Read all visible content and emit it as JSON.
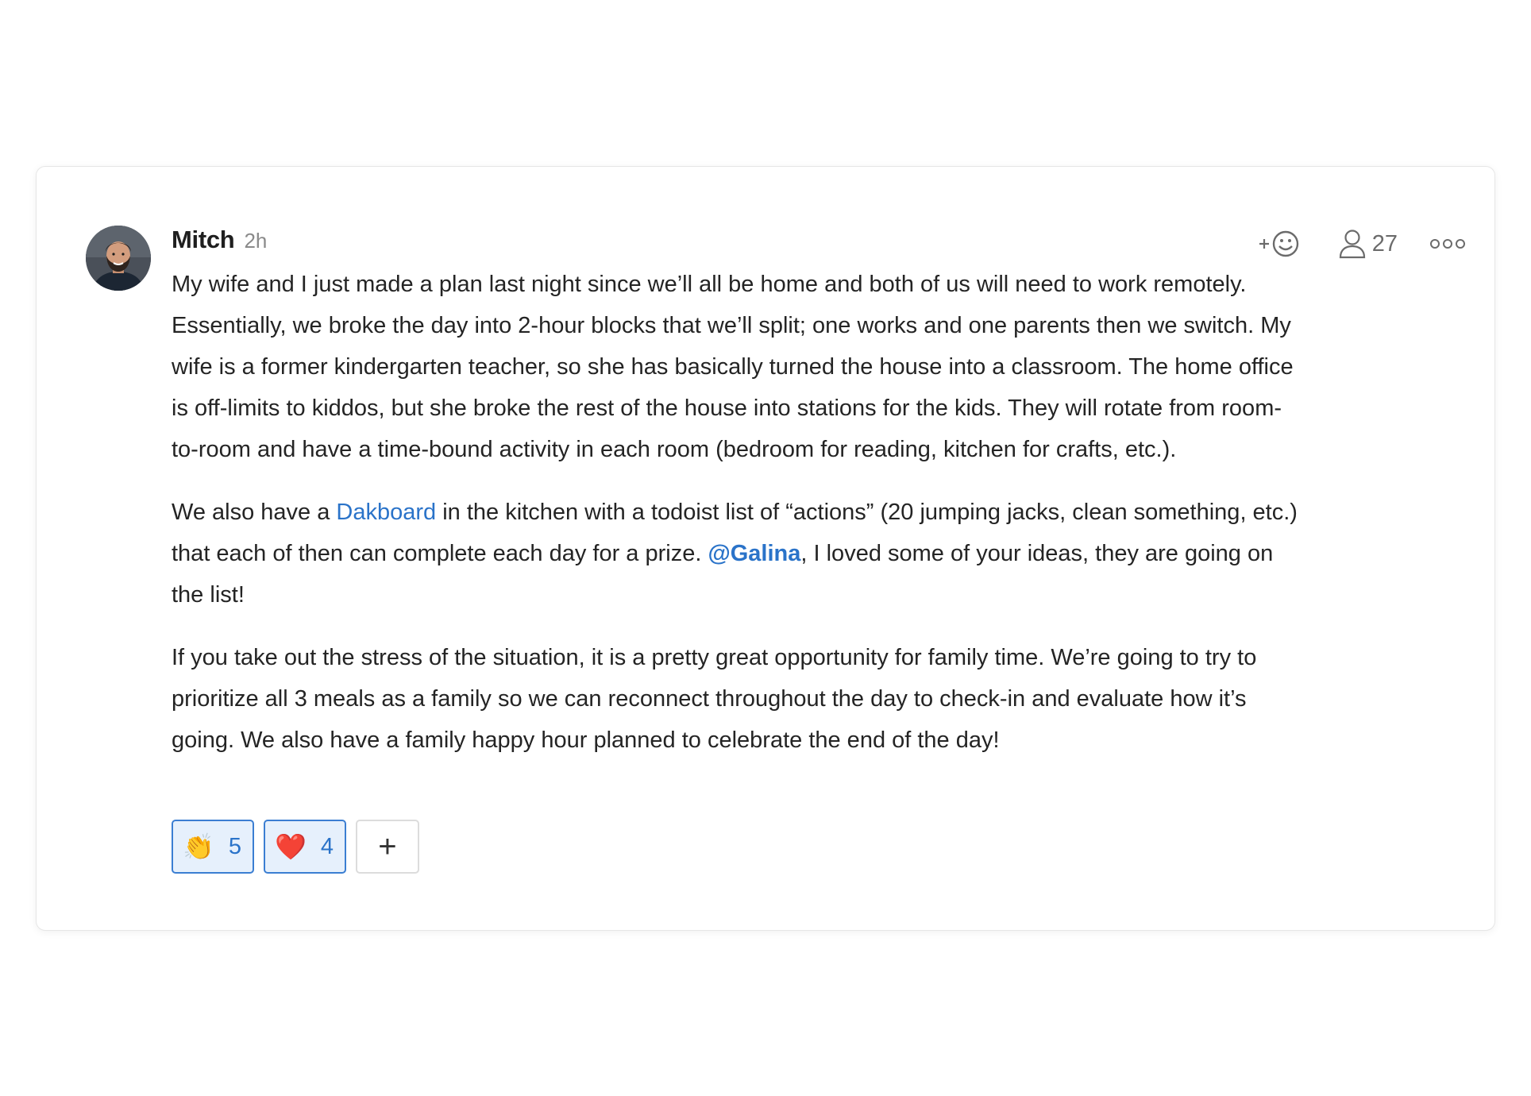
{
  "post": {
    "author": "Mitch",
    "time": "2h",
    "participants_count": "27",
    "paragraphs": {
      "p1": "My wife and I just made a plan last night since we’ll all be home and both of us will need to work remotely. Essentially, we broke the day into 2-hour blocks that we’ll split; one works and one parents then we switch. My wife is a former kindergarten teacher, so she has basically turned the house into a classroom. The home office is off-limits to kiddos, but she broke the rest of the house into stations for the kids. They will rotate from room-to-room and have a time-bound activity in each room (bedroom for reading, kitchen for crafts, etc.).",
      "p2_pre": "We also have a ",
      "p2_link": "Dakboard",
      "p2_mid": " in the kitchen with a todoist list of “actions” (20 jumping jacks, clean something, etc.) that each of then can complete each day for a prize. ",
      "p2_mention": "@Galina",
      "p2_post": ", I loved some of your ideas, they are going on the list!",
      "p3": "If you take out the stress of the situation, it is a pretty great opportunity for family time. We’re going to try to prioritize all 3 meals as a family so we can reconnect throughout the day to check-in and evaluate how it’s going. We also have a family happy hour planned to celebrate the end of the day!"
    },
    "reactions": [
      {
        "emoji": "👏",
        "count": "5",
        "icon": "clapping-hands-icon"
      },
      {
        "emoji": "❤️",
        "count": "4",
        "icon": "red-heart-icon"
      }
    ],
    "add_reaction_label": "+"
  },
  "icons": {
    "add_reaction": "add-emoji-icon",
    "participants": "person-icon",
    "more": "more-options-icon"
  },
  "colors": {
    "link": "#2a73c9",
    "reaction_active_bg": "#e6f0fc",
    "reaction_active_border": "#3b7ed2",
    "icon_gray": "#6b6b6b"
  }
}
